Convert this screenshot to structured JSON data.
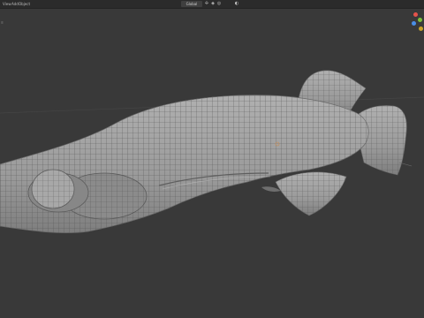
{
  "header": {
    "menus": [
      "View",
      "Add",
      "Object"
    ],
    "orientation": {
      "label": "Global"
    },
    "icons": [
      "cursor-icon",
      "snap-icon",
      "proportional-edit-icon",
      "overlay-icon"
    ]
  },
  "viewport": {
    "left_panel_tag": "☰",
    "gizmo_icons": [
      "axis-x-icon",
      "axis-y-icon",
      "axis-z-icon"
    ]
  },
  "colors": {
    "header_bg": "#2b2b2b",
    "viewport_bg": "#393939",
    "mesh_fill": "#9b9b9b",
    "mesh_wire": "#5a5a5a",
    "axis_x": "#e5534b",
    "axis_y": "#7cbf3b",
    "axis_z": "#4a8ee6"
  }
}
